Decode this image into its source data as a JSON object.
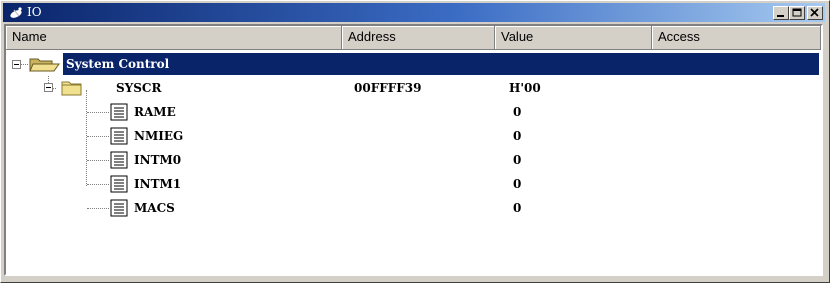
{
  "window": {
    "title": "IO"
  },
  "columns": [
    {
      "label": "Name"
    },
    {
      "label": "Address"
    },
    {
      "label": "Value"
    },
    {
      "label": "Access"
    }
  ],
  "tree": {
    "group": {
      "name": "System Control",
      "address": "",
      "value": ""
    },
    "register": {
      "name": "SYSCR",
      "address": "00FFFF39",
      "value": "H'00"
    },
    "bits": [
      {
        "name": "RAME",
        "value": "0"
      },
      {
        "name": "NMIEG",
        "value": "0"
      },
      {
        "name": "INTM0",
        "value": "0"
      },
      {
        "name": "INTM1",
        "value": "0"
      },
      {
        "name": "MACS",
        "value": "0"
      }
    ]
  },
  "colors": {
    "titlebar_start": "#0a246a",
    "titlebar_end": "#a6caf0",
    "selection": "#0a246a",
    "folder": "#f0e090"
  },
  "icons": {
    "window": "satellite-dish-icon",
    "group": "open-folder-icon",
    "register": "folder-icon",
    "bit": "document-lines-icon"
  }
}
